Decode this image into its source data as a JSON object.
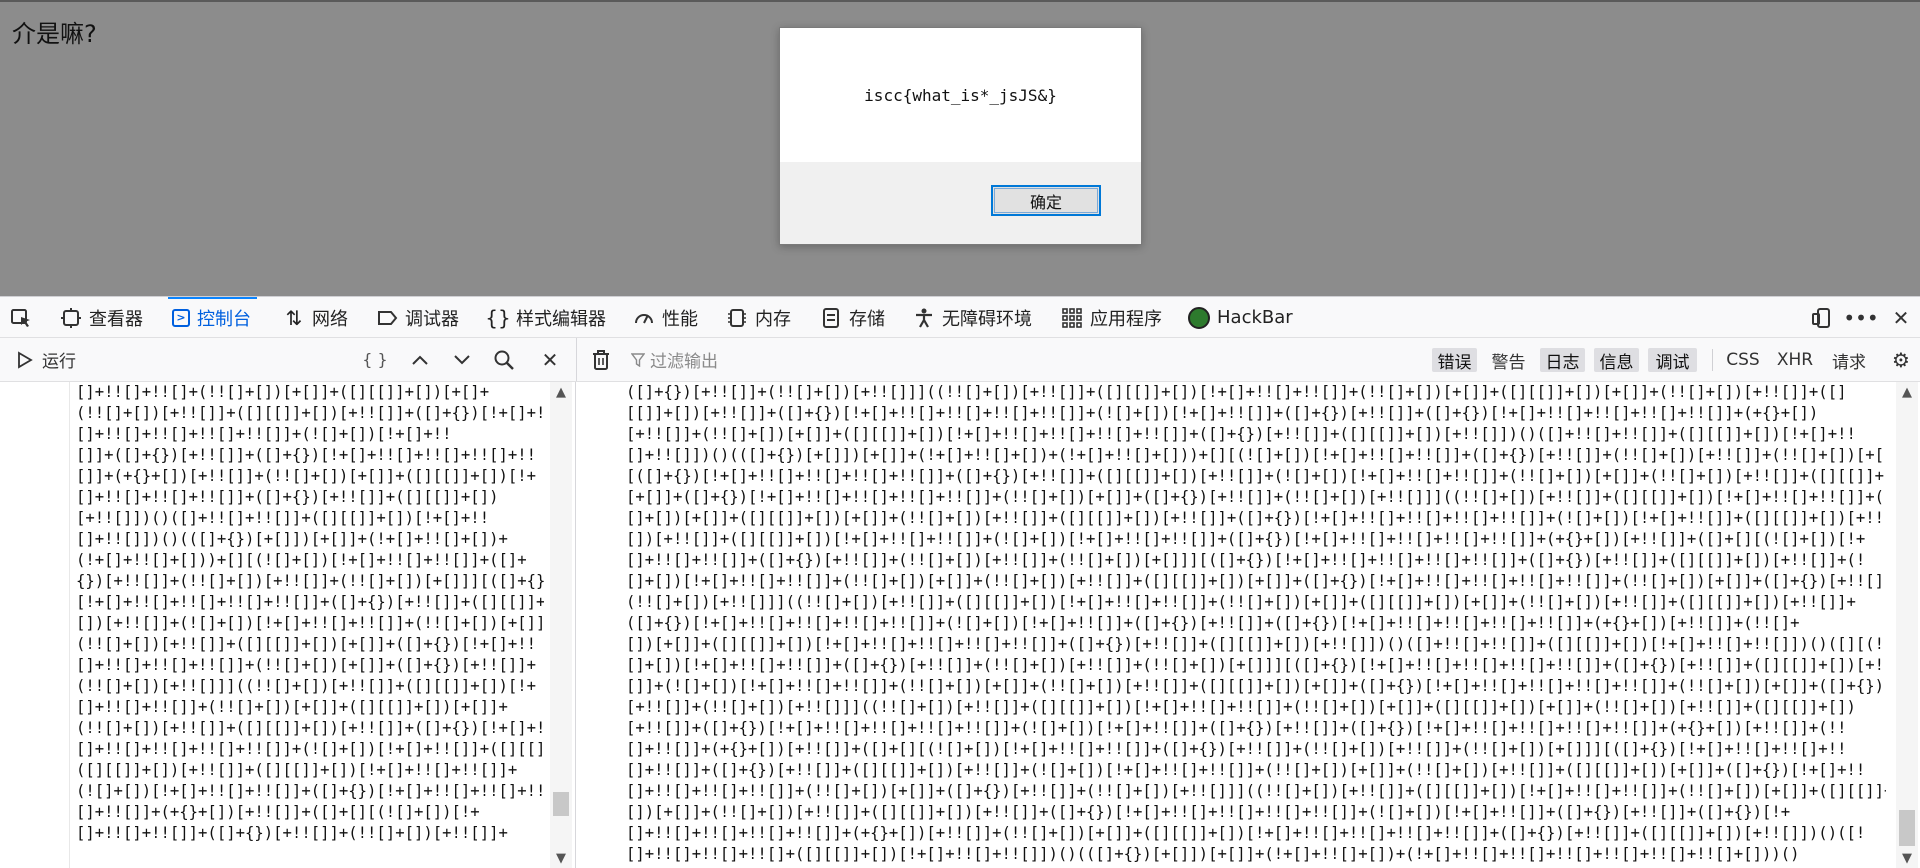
{
  "page": {
    "heading": "介是嘛?"
  },
  "dialog": {
    "message": "iscc{what_is*_jsJS&}",
    "ok_label": "确定"
  },
  "devtools": {
    "tabs": [
      {
        "label": "查看器",
        "icon": "inspector-icon"
      },
      {
        "label": "控制台",
        "icon": "console-icon",
        "active": true
      },
      {
        "label": "网络",
        "icon": "network-icon"
      },
      {
        "label": "调试器",
        "icon": "debugger-icon"
      },
      {
        "label": "样式编辑器",
        "icon": "style-editor-icon"
      },
      {
        "label": "性能",
        "icon": "performance-icon"
      },
      {
        "label": "内存",
        "icon": "memory-icon"
      },
      {
        "label": "存储",
        "icon": "storage-icon"
      },
      {
        "label": "无障碍环境",
        "icon": "accessibility-icon"
      },
      {
        "label": "应用程序",
        "icon": "application-icon"
      },
      {
        "label": "HackBar",
        "icon": "hackbar-icon"
      }
    ],
    "right_icons": [
      "responsive-design-icon",
      "more-options-icon",
      "close-icon"
    ]
  },
  "console": {
    "run_label": "运行",
    "pretty_print": "{ }",
    "filter_placeholder": "过滤输出",
    "filters": [
      {
        "label": "错误",
        "active": true
      },
      {
        "label": "警告",
        "active": false
      },
      {
        "label": "日志",
        "active": true
      },
      {
        "label": "信息",
        "active": true
      },
      {
        "label": "调试",
        "active": true
      }
    ],
    "request_filters": [
      "CSS",
      "XHR",
      "请求"
    ],
    "editor_lines": [
      "[]+!![]+!![]+(!![]+[])[+[]]+([][[]]+[])[+[]+",
      "(!![]+[])[+!![]]+([][[]]+[])[+!![]]+([]+{})[!+[]+!!",
      "[]+!![]+!![]+!![]+!![]]+(![]+[])[!+[]+!!",
      "[]]+([]+{})[+!![]]+([]+{})[!+[]+!![]+!![]+!![]+!!",
      "[]]+(+{}+[])[+!![]]+(!![]+[])[+[]]+([][[]]+[])[!+",
      "[]+!![]+!![]+!![]]+([]+{})[+!![]]+([][[]]+[])",
      "[+!![]])()([]+!![]+!![]]+([][[]]+[])[!+[]+!!",
      "[]+!![]])()(([]+{})[+[]])[+[]]+(!+[]+!![]+[])+",
      "(!+[]+!![]+[]))+[][(![]+[])[!+[]+!![]+!![]]+([]+",
      "{})[+!![]]+(!![]+[])[+!![]]+(!![]+[])[+[]]][([]+{})",
      "[!+[]+!![]+!![]+!![]+!![]]+([]+{})[+!![]]+([][[]]+",
      "[])[+!![]]+(![]+[])[!+[]+!![]+!![]]+(!![]+[])[+[]]+",
      "(!![]+[])[+!![]]+([][[]]+[])[+[]]+([]+{})[!+[]+!!",
      "[]+!![]+!![]+!![]]+(!![]+[])[+[]]+([]+{})[+!![]]+",
      "(!![]+[])[+!![]]]((!![]+[])[+!![]]+([][[]]+[])[!+",
      "[]+!![]+!![]]+(!![]+[])[+[]]+([][[]]+[])[+[]]+",
      "(!![]+[])[+!![]]+([][[]]+[])[+!![]]+([]+{})[!+[]+!!",
      "[]+!![]+!![]+!![]+!![]]+(![]+[])[!+[]+!![]]+([][[]]+",
      "([][[]]+[])[+!![]]+([][[]]+[])[!+[]+!![]+!![]]+",
      "(![]+[])[!+[]+!![]+!![]]+([]+{})[!+[]+!![]+!![]+!!",
      "[]+!![]]+(+{}+[])[+!![]]+([]+[][(![]+[])[!+",
      "[]+!![]+!![]]+([]+{})[+!![]]+(!![]+[])[+!![]]+"
    ],
    "output_lines": [
      "([]+{})[+!![]]+(!![]+[])[+!![]]]((!![]+[])[+!![]]+([][[]]+[])[!+[]+!![]+!![]]+(!![]+[])[+[]]+([][[]]+[])[+[]]+(!![]+[])[+!![]]+([]",
      "[[]]+[])[+!![]]+([]+{})[!+[]+!![]+!![]+!![]+!![]]+(![]+[])[!+[]+!![]]+([]+{})[+!![]]+([]+{})[!+[]+!![]+!![]+!![]+!![]]+(+{}+[])",
      "[+!![]]+(!![]+[])[+[]]+([][[]]+[])[!+[]+!![]+!![]+!![]+!![]]+([]+{})[+!![]]+([][[]]+[])[+!![]])()([]+!![]+!![]]+([][[]]+[])[!+[]+!!",
      "[]+!![]])()(([]+{})[+[]])[+[]]+(!+[]+!![]+[])+(!+[]+!![]+[]))+[][(![]+[])[!+[]+!![]+!![]]+([]+{})[+!![]]+(!![]+[])[+!![]]+(!![]+[])[+[]]]",
      "[([]+{})[!+[]+!![]+!![]+!![]+!![]]+([]+{})[+!![]]+([][[]]+[])[+!![]]+(![]+[])[!+[]+!![]+!![]]+(!![]+[])[+[]]+(!![]+[])[+!![]]+([][[]]+[])",
      "[+[]]+([]+{})[!+[]+!![]+!![]+!![]+!![]]+(!![]+[])[+[]]+([]+{})[+!![]]+(!![]+[])[+!![]]]((!![]+[])[+!![]]+([][[]]+[])[!+[]+!![]+!![]]+(!!",
      "[]+[])[+[]]+([][[]]+[])[+[]]+(!![]+[])[+!![]]+([][[]]+[])[+!![]]+([]+{})[!+[]+!![]+!![]+!![]+!![]]+(![]+[])[!+[]+!![]]+([][[]]+[])[+!![]]+([][[]]+",
      "[])[+!![]]+([][[]]+[])[!+[]+!![]+!![]]+(![]+[])[!+[]+!![]+!![]]+([]+{})[!+[]+!![]+!![]+!![]+!![]]+(+{}+[])[+!![]]+([]+[][(![]+[])[!+",
      "[]+!![]+!![]]+([]+{})[+!![]]+(!![]+[])[+!![]]+(!![]+[])[+[]]][([]+{})[!+[]+!![]+!![]+!![]+!![]]+([]+{})[+!![]]+([][[]]+[])[+!![]]+(!",
      "[]+[])[!+[]+!![]+!![]]+(!![]+[])[+[]]+(!![]+[])[+!![]]+([][[]]+[])[+[]]+([]+{})[!+[]+!![]+!![]+!![]+!![]]+(!![]+[])[+[]]+([]+{})[+!![]]+",
      "(!![]+[])[+!![]]]((!![]+[])[+!![]]+([][[]]+[])[!+[]+!![]+!![]]+(!![]+[])[+[]]+([][[]]+[])[+[]]+(!![]+[])[+!![]]+([][[]]+[])[+!![]]+",
      "([]+{})[!+[]+!![]+!![]+!![]+!![]]+(![]+[])[!+[]+!![]]+([]+{})[+!![]]+([]+{})[!+[]+!![]+!![]+!![]+!![]]+(+{}+[])[+!![]]+(!![]+",
      "[])[+[]]+([][[]]+[])[!+[]+!![]+!![]+!![]+!![]]+([]+{})[+!![]]+([][[]]+[])[+!![]])()([]+!![]+!![]]+([][[]]+[])[!+[]+!![]+!![]])()([][(!",
      "[]+[])[!+[]+!![]+!![]]+([]+{})[+!![]]+(!![]+[])[+!![]]+(!![]+[])[+[]]][([]+{})[!+[]+!![]+!![]+!![]+!![]]+([]+{})[+!![]]+([][[]]+[])[+!!",
      "[]]+(![]+[])[!+[]+!![]+!![]]+(!![]+[])[+[]]+(!![]+[])[+!![]]+([][[]]+[])[+[]]+([]+{})[!+[]+!![]+!![]+!![]+!![]]+(!![]+[])[+[]]+([]+{})",
      "[+!![]]+(!![]+[])[+!![]]]((!![]+[])[+!![]]+([][[]]+[])[!+[]+!![]+!![]]+(!![]+[])[+[]]+([][[]]+[])[+[]]+(!![]+[])[+!![]]+([][[]]+[])",
      "[+!![]]+([]+{})[!+[]+!![]+!![]+!![]+!![]]+(![]+[])[!+[]+!![]]+([]+{})[+!![]]+([]+{})[!+[]+!![]+!![]+!![]+!![]]+(+{}+[])[+!![]]+(!!",
      "[]+!![]]+(+{}+[])[+!![]]+([]+[][(![]+[])[!+[]+!![]+!![]]+([]+{})[+!![]]+(!![]+[])[+!![]]+(!![]+[])[+[]]][([]+{})[!+[]+!![]+!![]+!!",
      "[]+!![]]+([]+{})[+!![]]+([][[]]+[])[+!![]]+(![]+[])[!+[]+!![]+!![]]+(!![]+[])[+[]]+(!![]+[])[+!![]]+([][[]]+[])[+[]]+([]+{})[!+[]+!!",
      "[]+!![]+!![]+!![]]+(!![]+[])[+[]]+([]+{})[+!![]]+(!![]+[])[+!![]]]((!![]+[])[+!![]]+([][[]]+[])[!+[]+!![]+!![]]+(!![]+[])[+[]]+([][[]]+",
      "[])[+[]]+(!![]+[])[+!![]]+([][[]]+[])[+!![]]+([]+{})[!+[]+!![]+!![]+!![]+!![]]+(![]+[])[!+[]+!![]]+([]+{})[+!![]]+([]+{})[!+",
      "[]+!![]+!![]+!![]+!![]]+(+{}+[])[+!![]]+(!![]+[])[+[]]+([][[]]+[])[!+[]+!![]+!![]+!![]+!![]]+([]+{})[+!![]]+([][[]]+[])[+!![]])()([!",
      "[]+!![]+!![]+!![]+([][[]]+[])[!+[]+!![]+!![]])()(([]+{})[+[]])[+[]]+(!+[]+!![]+[])+(!+[]+!![]+!![]+!![]+!![]+!![]+!![]+[]))()"
    ]
  }
}
